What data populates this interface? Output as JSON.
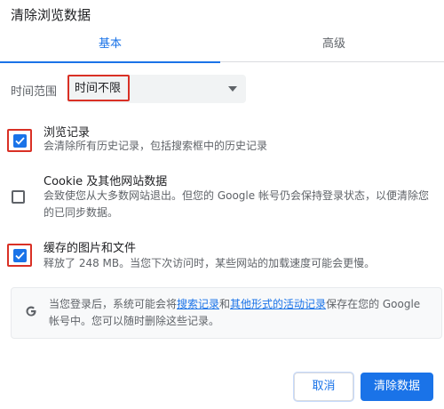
{
  "dialog": {
    "title": "清除浏览数据"
  },
  "tabs": [
    {
      "label": "基本",
      "active": true
    },
    {
      "label": "高级",
      "active": false
    }
  ],
  "time_range": {
    "label": "时间范围",
    "selected": "时间不限"
  },
  "options": [
    {
      "title": "浏览记录",
      "description": "会清除所有历史记录，包括搜索框中的历史记录",
      "checked": true
    },
    {
      "title": "Cookie 及其他网站数据",
      "description": "会致使您从大多数网站退出。但您的 Google 帐号仍会保持登录状态，以便清除您的已同步数据。",
      "checked": false
    },
    {
      "title": "缓存的图片和文件",
      "description": "释放了 248 MB。当您下次访问时，某些网站的加载速度可能会更慢。",
      "checked": true
    }
  ],
  "info": {
    "text_before": "当您登录后，系统可能会将",
    "link1": "搜索记录",
    "text_mid": "和",
    "link2": "其他形式的活动记录",
    "text_after": "保存在您的 Google 帐号中。您可以随时删除这些记录。",
    "icon": "google-g-icon"
  },
  "buttons": {
    "cancel": "取消",
    "clear": "清除数据"
  },
  "colors": {
    "accent": "#1a73e8",
    "highlight": "#d93025"
  }
}
